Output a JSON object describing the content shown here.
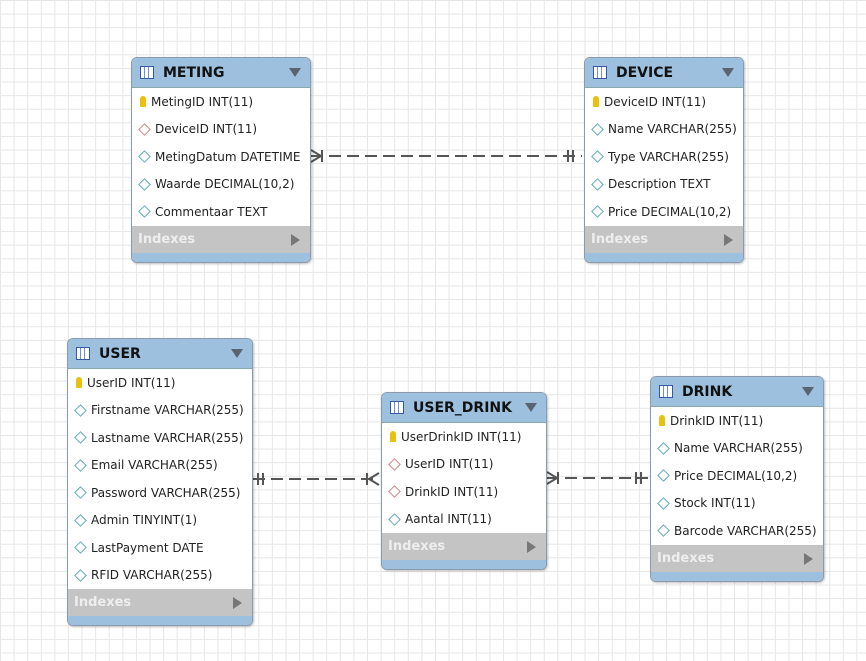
{
  "tables": {
    "meting": {
      "name": "METING",
      "indexes": "Indexes",
      "columns": [
        {
          "label": "MetingID INT(11)",
          "kind": "pk"
        },
        {
          "label": "DeviceID INT(11)",
          "kind": "fk"
        },
        {
          "label": "MetingDatum DATETIME",
          "kind": "col"
        },
        {
          "label": "Waarde DECIMAL(10,2)",
          "kind": "col"
        },
        {
          "label": "Commentaar TEXT",
          "kind": "col"
        }
      ]
    },
    "device": {
      "name": "DEVICE",
      "indexes": "Indexes",
      "columns": [
        {
          "label": "DeviceID INT(11)",
          "kind": "pk"
        },
        {
          "label": "Name VARCHAR(255)",
          "kind": "col"
        },
        {
          "label": "Type VARCHAR(255)",
          "kind": "col"
        },
        {
          "label": "Description TEXT",
          "kind": "col"
        },
        {
          "label": "Price DECIMAL(10,2)",
          "kind": "col"
        }
      ]
    },
    "user": {
      "name": "USER",
      "indexes": "Indexes",
      "columns": [
        {
          "label": "UserID INT(11)",
          "kind": "pk"
        },
        {
          "label": "Firstname VARCHAR(255)",
          "kind": "col"
        },
        {
          "label": "Lastname VARCHAR(255)",
          "kind": "col"
        },
        {
          "label": "Email VARCHAR(255)",
          "kind": "col"
        },
        {
          "label": "Password VARCHAR(255)",
          "kind": "col"
        },
        {
          "label": "Admin TINYINT(1)",
          "kind": "col"
        },
        {
          "label": "LastPayment DATE",
          "kind": "col"
        },
        {
          "label": "RFID VARCHAR(255)",
          "kind": "col"
        }
      ]
    },
    "user_drink": {
      "name": "USER_DRINK",
      "indexes": "Indexes",
      "columns": [
        {
          "label": "UserDrinkID INT(11)",
          "kind": "pk"
        },
        {
          "label": "UserID INT(11)",
          "kind": "fk"
        },
        {
          "label": "DrinkID INT(11)",
          "kind": "fk"
        },
        {
          "label": "Aantal INT(11)",
          "kind": "col"
        }
      ]
    },
    "drink": {
      "name": "DRINK",
      "indexes": "Indexes",
      "columns": [
        {
          "label": "DrinkID INT(11)",
          "kind": "pk"
        },
        {
          "label": "Name VARCHAR(255)",
          "kind": "col"
        },
        {
          "label": "Price DECIMAL(10,2)",
          "kind": "col"
        },
        {
          "label": "Stock INT(11)",
          "kind": "col"
        },
        {
          "label": "Barcode VARCHAR(255)",
          "kind": "col"
        }
      ]
    }
  },
  "colors": {
    "header": "#9cc0de",
    "indexes": "#c4c4c4",
    "line": "#555555"
  }
}
